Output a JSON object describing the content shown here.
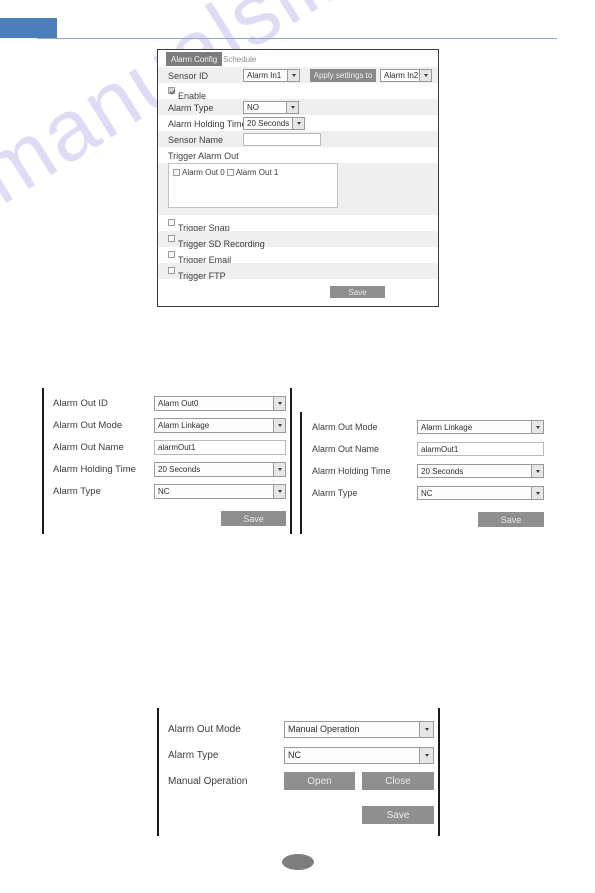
{
  "header": {
    "tab_label": ""
  },
  "watermark": {
    "text": "manualslib.com"
  },
  "alarm_config_panel": {
    "tabs": [
      {
        "label": "Alarm Config",
        "active": true
      },
      {
        "label": "Schedule",
        "active": false
      }
    ],
    "sensor_id_label": "Sensor ID",
    "sensor_id_value": "Alarm In1",
    "apply_settings_label": "Apply settings to",
    "apply_target_value": "Alarm In2",
    "enable_label": "Enable",
    "enable_checked": true,
    "alarm_type_label": "Alarm Type",
    "alarm_type_value": "NO",
    "holding_time_label": "Alarm Holding Time",
    "holding_time_value": "20 Seconds",
    "sensor_name_label": "Sensor Name",
    "sensor_name_value": "",
    "trigger_alarm_out_label": "Trigger Alarm Out",
    "alarm_out_options": [
      {
        "label": "Alarm Out 0",
        "checked": false
      },
      {
        "label": "Alarm Out 1",
        "checked": false
      }
    ],
    "triggers": [
      {
        "label": "Trigger Snap",
        "checked": false
      },
      {
        "label": "Trigger SD Recording",
        "checked": false
      },
      {
        "label": "Trigger Email",
        "checked": false
      },
      {
        "label": "Trigger FTP",
        "checked": false
      }
    ],
    "save_label": "Save"
  },
  "alarm_out_left_panel": {
    "alarm_out_id_label": "Alarm Out ID",
    "alarm_out_id_value": "Alarm Out0",
    "alarm_out_mode_label": "Alarm Out Mode",
    "alarm_out_mode_value": "Alarm Linkage",
    "alarm_out_name_label": "Alarm Out Name",
    "alarm_out_name_value": "alarmOut1",
    "holding_time_label": "Alarm Holding Time",
    "holding_time_value": "20 Seconds",
    "alarm_type_label": "Alarm Type",
    "alarm_type_value": "NC",
    "save_label": "Save"
  },
  "alarm_out_right_panel": {
    "alarm_out_mode_label": "Alarm Out Mode",
    "alarm_out_mode_value": "Alarm Linkage",
    "alarm_out_name_label": "Alarm Out Name",
    "alarm_out_name_value": "alarmOut1",
    "holding_time_label": "Alarm Holding Time",
    "holding_time_value": "20 Seconds",
    "alarm_type_label": "Alarm Type",
    "alarm_type_value": "NC",
    "save_label": "Save"
  },
  "manual_operation_panel": {
    "alarm_out_mode_label": "Alarm Out Mode",
    "alarm_out_mode_value": "Manual Operation",
    "alarm_type_label": "Alarm Type",
    "alarm_type_value": "NC",
    "manual_operation_label": "Manual Operation",
    "open_label": "Open",
    "close_label": "Close",
    "save_label": "Save"
  },
  "footer": {
    "page_number": ""
  },
  "colors": {
    "header_tab_blue": "#4c7ebb",
    "header_rule": "#8faac9",
    "button_grey": "#8f8f8f",
    "active_tab_grey": "#7c7c7c",
    "watermark_purple": "#c9c8ee",
    "row_alt": "#efefef"
  }
}
